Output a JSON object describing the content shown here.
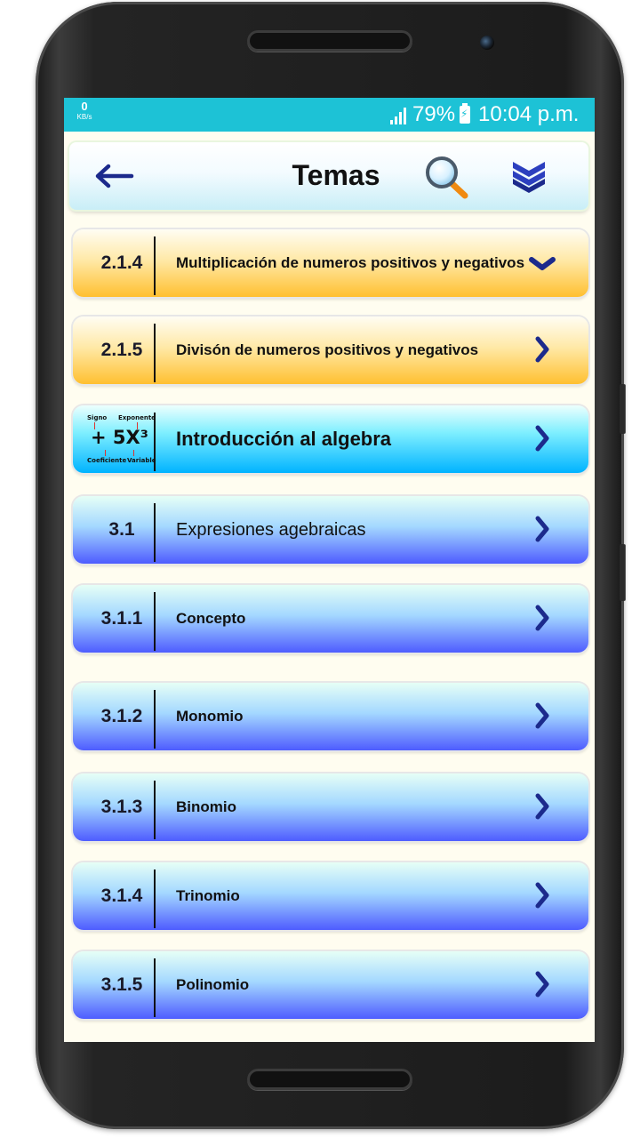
{
  "status_bar": {
    "data_rate_value": "0",
    "data_rate_unit": "KB/s",
    "battery_percent": "79%",
    "time": "10:04 p.m.",
    "background_color": "#1dc2d6"
  },
  "toolbar": {
    "title": "Temas",
    "back_icon": "arrow-left-icon",
    "search_icon": "magnifier-icon",
    "collapse_icon": "double-chevron-down-icon"
  },
  "algebra_illustration": {
    "sign_label": "Signo",
    "exponent_label": "Exponente",
    "expression": "+ 5X³",
    "coefficient_label": "Coeficiente",
    "variable_label": "Variable"
  },
  "topics": [
    {
      "number": "2.1.4",
      "label": "Multiplicación de numeros positivos y negativos",
      "style": "orange",
      "indicator": "chevron-down-icon"
    },
    {
      "number": "2.1.5",
      "label": "Divisón de numeros positivos y negativos",
      "style": "orange",
      "indicator": "chevron-right-icon"
    },
    {
      "number": "",
      "label": "Introducción al algebra",
      "style": "cyan",
      "indicator": "chevron-right-icon"
    },
    {
      "number": "3.1",
      "label": "Expresiones agebraicas",
      "style": "blue",
      "indicator": "chevron-right-icon"
    },
    {
      "number": "3.1.1",
      "label": "Concepto",
      "style": "blue",
      "indicator": "chevron-right-icon"
    },
    {
      "number": "3.1.2",
      "label": "Monomio",
      "style": "blue",
      "indicator": "chevron-right-icon"
    },
    {
      "number": "3.1.3",
      "label": "Binomio",
      "style": "blue",
      "indicator": "chevron-right-icon"
    },
    {
      "number": "3.1.4",
      "label": "Trinomio",
      "style": "blue",
      "indicator": "chevron-right-icon"
    },
    {
      "number": "3.1.5",
      "label": "Polinomio",
      "style": "blue",
      "indicator": "chevron-right-icon"
    }
  ],
  "colors": {
    "chevron": "#1c2a8c",
    "orange_item": "#ffc030",
    "cyan_item": "#00b3ff",
    "blue_item": "#4e5cff"
  }
}
